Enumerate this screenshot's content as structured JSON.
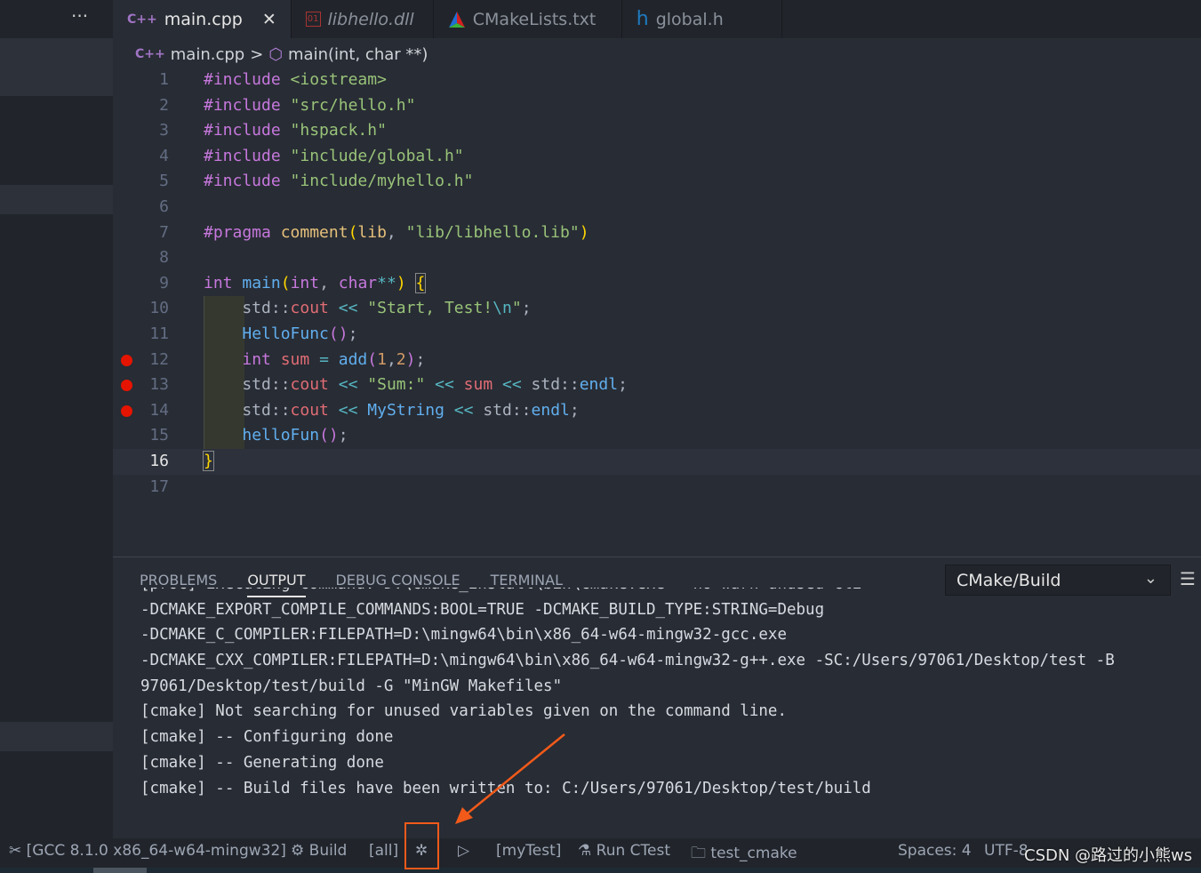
{
  "tabs": [
    {
      "label": "main.cpp",
      "icon": "cpp-file-icon",
      "active": true,
      "close": "✕"
    },
    {
      "label": "libhello.dll",
      "icon": "binary-file-icon"
    },
    {
      "label": "CMakeLists.txt",
      "icon": "cmake-icon"
    },
    {
      "label": "global.h",
      "icon": "header-file-icon"
    }
  ],
  "more": "···",
  "breadcrumb": {
    "file": "main.cpp",
    "sep": ">",
    "symbol": "main(int, char **)"
  },
  "editor": {
    "current_line": 16,
    "breakpoints": [
      12,
      13,
      14
    ],
    "lines": [
      [
        [
          "#include ",
          "k"
        ],
        [
          "<iostream>",
          "s"
        ]
      ],
      [
        [
          "#include ",
          "k"
        ],
        [
          "\"src/hello.h\"",
          "s"
        ]
      ],
      [
        [
          "#include ",
          "k"
        ],
        [
          "\"hspack.h\"",
          "s"
        ]
      ],
      [
        [
          "#include ",
          "k"
        ],
        [
          "\"include/global.h\"",
          "s"
        ]
      ],
      [
        [
          "#include ",
          "k"
        ],
        [
          "\"include/myhello.h\"",
          "s"
        ]
      ],
      [],
      [
        [
          "#pragma ",
          "k"
        ],
        [
          "comment",
          "y"
        ],
        [
          "(",
          "b"
        ],
        [
          "lib",
          "y"
        ],
        [
          ", ",
          "t"
        ],
        [
          "\"lib/libhello.lib\"",
          "s"
        ],
        [
          ")",
          "b"
        ]
      ],
      [],
      [
        [
          "int ",
          "k"
        ],
        [
          "main",
          "f"
        ],
        [
          "(",
          "b"
        ],
        [
          "int",
          "k"
        ],
        [
          ", ",
          "t"
        ],
        [
          "char",
          "k"
        ],
        [
          "**",
          "o"
        ],
        [
          ")",
          "b"
        ],
        [
          " ",
          "t"
        ],
        [
          "{",
          "b box"
        ]
      ],
      [
        [
          "    std::",
          "t"
        ],
        [
          "cout",
          "r"
        ],
        [
          " << ",
          "o"
        ],
        [
          "\"Start, Test!",
          "s"
        ],
        [
          "\\n",
          "o"
        ],
        [
          "\"",
          "s"
        ],
        [
          ";",
          "t"
        ]
      ],
      [
        [
          "    ",
          "t"
        ],
        [
          "HelloFunc",
          "f"
        ],
        [
          "()",
          "k"
        ],
        [
          ";",
          "t"
        ]
      ],
      [
        [
          "    ",
          "t"
        ],
        [
          "int ",
          "k"
        ],
        [
          "sum",
          "r"
        ],
        [
          " = ",
          "o"
        ],
        [
          "add",
          "f"
        ],
        [
          "(",
          "k"
        ],
        [
          "1",
          "n"
        ],
        [
          ",",
          "t"
        ],
        [
          "2",
          "n"
        ],
        [
          ")",
          "k"
        ],
        [
          ";",
          "t"
        ]
      ],
      [
        [
          "    std::",
          "t"
        ],
        [
          "cout",
          "r"
        ],
        [
          " << ",
          "o"
        ],
        [
          "\"Sum:\"",
          "s"
        ],
        [
          " << ",
          "o"
        ],
        [
          "sum",
          "r"
        ],
        [
          " << ",
          "o"
        ],
        [
          "std::",
          "t"
        ],
        [
          "endl",
          "f"
        ],
        [
          ";",
          "t"
        ]
      ],
      [
        [
          "    std::",
          "t"
        ],
        [
          "cout",
          "r"
        ],
        [
          " << ",
          "o"
        ],
        [
          "MyString",
          "f"
        ],
        [
          " << ",
          "o"
        ],
        [
          "std::",
          "t"
        ],
        [
          "endl",
          "f"
        ],
        [
          ";",
          "t"
        ]
      ],
      [
        [
          "    ",
          "t"
        ],
        [
          "helloFun",
          "f"
        ],
        [
          "()",
          "k"
        ],
        [
          ";",
          "t"
        ]
      ],
      [
        [
          "}",
          "b box"
        ]
      ],
      []
    ]
  },
  "panel": {
    "tabs": [
      "PROBLEMS",
      "OUTPUT",
      "DEBUG CONSOLE",
      "TERMINAL"
    ],
    "active_tab": "OUTPUT",
    "channel": "CMake/Build",
    "output": [
      "[proc] Executing command: D:\\cmake_install\\bin\\cmake.exe --no-warn-unused-cli",
      "-DCMAKE_EXPORT_COMPILE_COMMANDS:BOOL=TRUE -DCMAKE_BUILD_TYPE:STRING=Debug",
      "-DCMAKE_C_COMPILER:FILEPATH=D:\\mingw64\\bin\\x86_64-w64-mingw32-gcc.exe",
      "-DCMAKE_CXX_COMPILER:FILEPATH=D:\\mingw64\\bin\\x86_64-w64-mingw32-g++.exe -SC:/Users/97061/Desktop/test -B",
      "97061/Desktop/test/build -G \"MinGW Makefiles\"",
      "[cmake] Not searching for unused variables given on the command line.",
      "[cmake] -- Configuring done",
      "[cmake] -- Generating done",
      "[cmake] -- Build files have been written to: C:/Users/97061/Desktop/test/build"
    ]
  },
  "status": {
    "kit": "[GCC 8.1.0 x86_64-w64-mingw32]",
    "build": "Build",
    "target": "[all]",
    "launch_target": "[myTest]",
    "ctest": "Run CTest",
    "folder": "test_cmake",
    "spaces": "Spaces: 4",
    "encoding": "UTF-8"
  },
  "watermark": "CSDN @路过的小熊ws",
  "colors": {
    "accent_annotation": "#f25a1a",
    "breakpoint": "#e51400"
  }
}
